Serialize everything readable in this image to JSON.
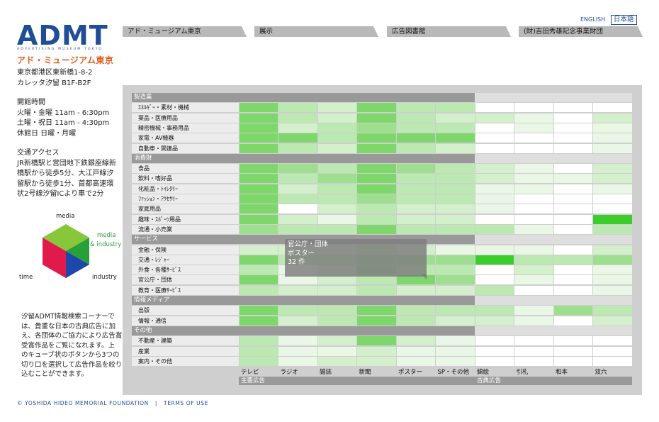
{
  "header": {
    "logo_text": "ADMT",
    "logo_sub": "ADVERTISING MUSEUM TOKYO",
    "logo_ja": "アド・ミュージアム東京",
    "lang_en": "ENGLISH",
    "lang_ja": "日本語",
    "nav": [
      {
        "label": "アド・ミュージアム東京"
      },
      {
        "label": "展示"
      },
      {
        "label": "広告図書館"
      },
      {
        "label": "(財)吉田秀雄記念事業財団"
      }
    ]
  },
  "sidebar": {
    "address": [
      "東京都港区東新橋1-8-2",
      "カレッタ汐留 B1F-B2F"
    ],
    "hours": [
      "開館時間",
      "火曜・金曜 11am - 6:30pm",
      "土曜・祝日 11am - 4:30pm",
      "休館日 日曜・月曜"
    ],
    "access": [
      "交通アクセス",
      "JR新橋駅と営団地下鉄銀座線新",
      "橋駅から徒歩5分、大江戸線汐",
      "留駅から徒歩1分、首都高速環",
      "状2号線汐留ICより車で2分"
    ],
    "cube": {
      "top": "media",
      "right": "media",
      "right2": "& industry",
      "left": "time",
      "bottom": "industry",
      "colors": {
        "top": "#88c63a",
        "right": "#27a03a",
        "left": "#e01a4a",
        "bottom": "#1d47a8"
      }
    },
    "intro": [
      "汐留ADMT情報検索コーナーで",
      "は、貴重な日本の古典広告に加",
      "え、各団体のご協力により広告賞",
      "受賞作品をご覧になれます。上",
      "のキューブ状のボタンから3つの",
      "切り口を選択して広告作品を絞り",
      "込むことができます。"
    ]
  },
  "matrix": {
    "categories": [
      {
        "name": "製造業",
        "rows": [
          "ｴﾈﾙｷﾞｰ・素材・機械",
          "薬品・医療用品",
          "精密機械・事務用品",
          "家電・AV機器",
          "自動車・関連品"
        ]
      },
      {
        "name": "消費財",
        "rows": [
          "食品",
          "飲料・嗜好品",
          "化粧品・ﾄｲﾚﾀﾘｰ",
          "ﾌｧｯｼｮﾝ・ｱｸｾｻﾘｰ",
          "家庭用品",
          "趣味・ｽﾎﾟｰﾂ用品",
          "流通・小売業"
        ]
      },
      {
        "name": "サービス",
        "rows": [
          "金融・保険",
          "交通・ﾚｼﾞｬｰ",
          "外食・各種ｻｰﾋﾞｽ",
          "官公庁・団体",
          "教育・医療ｻｰﾋﾞｽ"
        ]
      },
      {
        "name": "情報メディア",
        "rows": [
          "出版",
          "情報・通信"
        ]
      },
      {
        "name": "その他",
        "rows": [
          "不動産・建築",
          "産業",
          "案内・その他"
        ]
      }
    ],
    "columns": [
      "テレビ",
      "ラジオ",
      "雑誌",
      "新聞",
      "ポスター",
      "SP・その他",
      "錦絵",
      "引札",
      "和本",
      "双六"
    ],
    "groups": [
      "主要広告",
      "古典広告"
    ],
    "tooltip": {
      "line1": "官公庁・団体",
      "line2": "ポスター",
      "line3": "32 件"
    }
  },
  "footer": {
    "copyright": "© YOSHIDA HIDEO MEMORIAL FOUNDATION",
    "sep": "|",
    "terms": "TERMS OF USE"
  }
}
